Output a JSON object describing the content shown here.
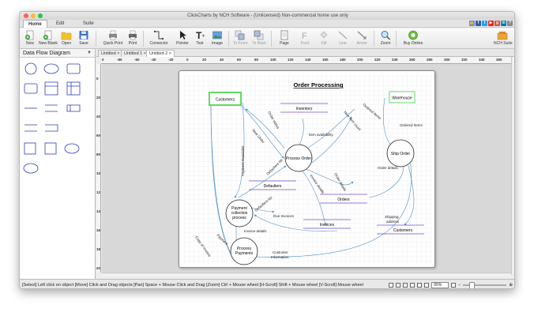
{
  "window": {
    "title": "ClickCharts by NCH Software - (Unlicensed) Non-commercial home use only"
  },
  "menu": {
    "tabs": [
      "Home",
      "Edit",
      "Suite"
    ]
  },
  "toolbar": {
    "new": "New",
    "new_blank": "New Blank",
    "open": "Open",
    "save": "Save",
    "quick_print": "Quick Print",
    "print": "Print",
    "connector": "Connector",
    "pointer": "Pointer",
    "text": "Text",
    "image": "Image",
    "to_front": "To Front",
    "to_back": "To Back",
    "page": "Page",
    "font": "Font",
    "fill": "Fill",
    "line": "Line",
    "arrow": "Arrow",
    "zoom": "Zoom",
    "buy_online": "Buy Online",
    "nch_suite": "NCH Suite"
  },
  "left_panel": {
    "title": "Data Flow Diagram"
  },
  "doc_tabs": [
    "Untitled",
    "Untitled 1",
    "Untitled 2"
  ],
  "ruler": {
    "h": [
      "0",
      "-80",
      "-60",
      "-40",
      "-20",
      "0",
      "20",
      "40",
      "60",
      "80",
      "100",
      "120",
      "140",
      "160",
      "180",
      "200",
      "220",
      "240",
      "260",
      "280",
      "300",
      "320",
      "340",
      "360"
    ],
    "v": [
      "0",
      "20",
      "40",
      "60",
      "80",
      "100",
      "120",
      "140",
      "160",
      "180",
      "200"
    ]
  },
  "diagram": {
    "title": "Order Processing",
    "entities": {
      "customers": "Customers",
      "warehouse": "Warehouse"
    },
    "processes": {
      "process_order": "Process Order",
      "ship_order": "Ship Order",
      "payment_line1": "Payment",
      "payment_line2": "collection",
      "payment_line3": "process",
      "process_payments_line1": "Process",
      "process_payments_line2": "Payments"
    },
    "stores": {
      "inventory": "Inventory",
      "defaulters": "Defaulters",
      "orders": "Orders",
      "invoices": "Invoices",
      "customers_store": "Customers"
    },
    "flows": {
      "order_status": "Order status",
      "new_item_count": "New item count",
      "ordered_items": "Ordered items",
      "ordered_items2": "Ordered Items",
      "item_availability": "Item availability",
      "new_order": "New Order",
      "payment_reminder": "Payment Reminder",
      "defaulters_list": "Defaulters list",
      "invoice_details": "Invoice details",
      "order_details": "Order details",
      "order_details2": "Order details",
      "defaulters_list2": "Defaulters list",
      "due_invoices": "Due Invoices",
      "invoice_details2": "Invoice details",
      "payment": "Payment",
      "copy_of_invoice": "Copy of Invoice",
      "customer_line1": "Customer",
      "customer_line2": "Information",
      "shipping_line1": "Shipping",
      "shipping_line2": "address"
    }
  },
  "status": {
    "text": "[Select] Left click on object  [Move] Click and Drag objects  [Pan] Space + Mouse Click and Drag  [Zoom] Ctrl + Mouse wheel  [H-Scroll] Shift + Mouse wheel  [V-Scroll] Mouse wheel",
    "zoom": "95%"
  },
  "colors": {
    "accent": "#3a6fc4",
    "entity_border": "#3bd13b",
    "store_line": "#7a4fc7",
    "flow": "#4a90c8"
  }
}
